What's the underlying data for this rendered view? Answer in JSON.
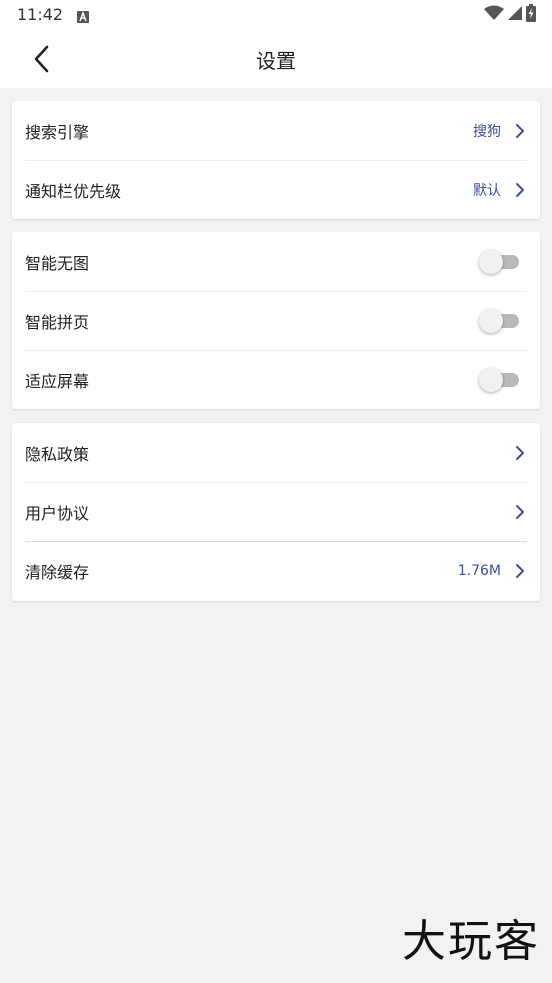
{
  "status_bar": {
    "time": "11:42",
    "icons": [
      "notification-a-icon",
      "wifi-icon",
      "signal-icon",
      "battery-charging-icon"
    ]
  },
  "header": {
    "title": "设置",
    "back_icon": "chevron-left-icon"
  },
  "groups": [
    {
      "items": [
        {
          "label": "搜索引擎",
          "value": "搜狗",
          "type": "nav"
        },
        {
          "label": "通知栏优先级",
          "value": "默认",
          "type": "nav"
        }
      ]
    },
    {
      "items": [
        {
          "label": "智能无图",
          "type": "toggle",
          "on": false
        },
        {
          "label": "智能拼页",
          "type": "toggle",
          "on": false
        },
        {
          "label": "适应屏幕",
          "type": "toggle",
          "on": false
        }
      ]
    },
    {
      "items": [
        {
          "label": "隐私政策",
          "type": "nav"
        },
        {
          "label": "用户协议",
          "type": "nav"
        },
        {
          "label": "清除缓存",
          "value": "1.76M",
          "type": "nav"
        }
      ]
    }
  ],
  "watermark": "大玩客",
  "colors": {
    "accent": "#3b4fa0",
    "background": "#f2f2f2",
    "toggle_off_track": "#b9b9b9"
  }
}
